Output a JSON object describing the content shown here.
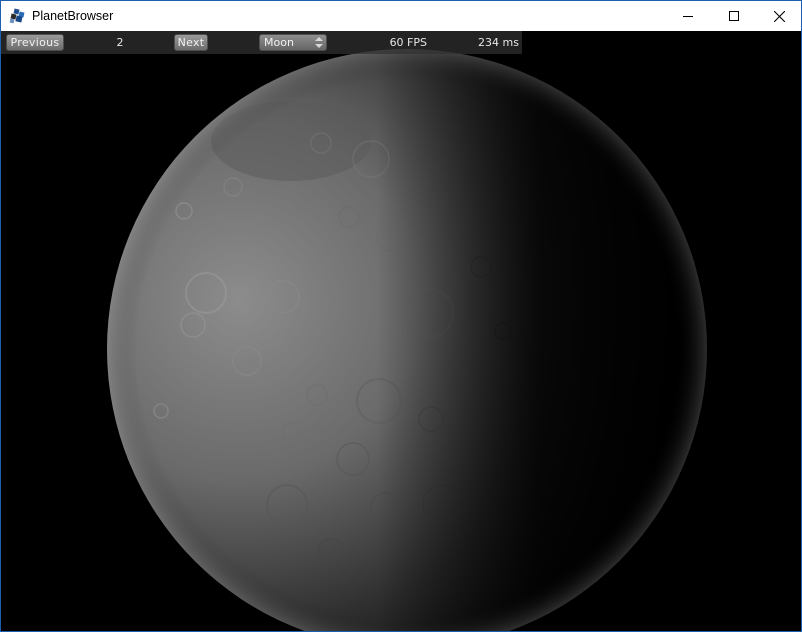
{
  "window": {
    "title": "PlanetBrowser",
    "app_icon": "planet-browser-logo-icon",
    "controls": [
      "minimize-icon",
      "maximize-icon",
      "close-icon"
    ]
  },
  "toolbar": {
    "previous_label": "Previous",
    "index": "2",
    "next_label": "Next",
    "planet_selected": "Moon",
    "fps": "60 FPS",
    "frame_time": "234 ms"
  },
  "scene": {
    "subject": "moon",
    "background_color": "#000000",
    "surface_color": "#8a8a8a"
  }
}
